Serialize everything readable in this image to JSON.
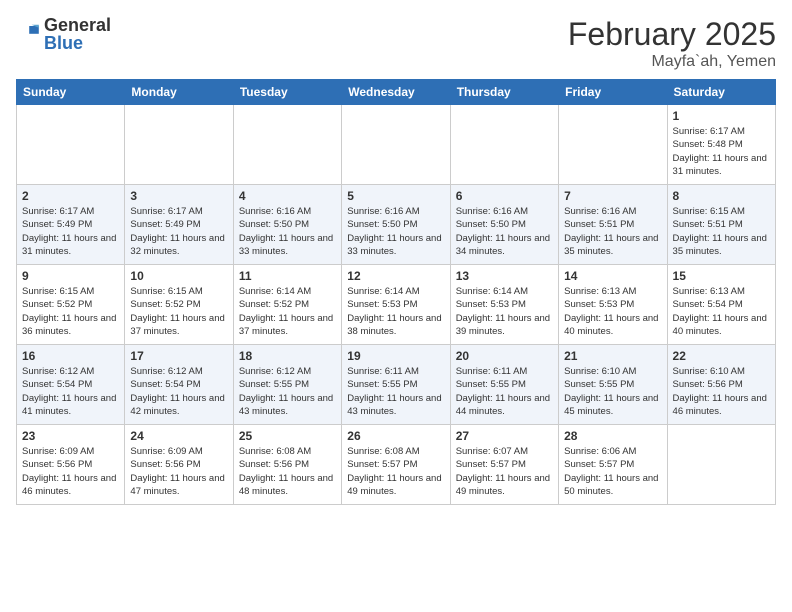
{
  "header": {
    "logo": {
      "general": "General",
      "blue": "Blue"
    },
    "month": "February 2025",
    "location": "Mayfa`ah, Yemen"
  },
  "weekdays": [
    "Sunday",
    "Monday",
    "Tuesday",
    "Wednesday",
    "Thursday",
    "Friday",
    "Saturday"
  ],
  "weeks": [
    [
      {
        "day": "",
        "info": ""
      },
      {
        "day": "",
        "info": ""
      },
      {
        "day": "",
        "info": ""
      },
      {
        "day": "",
        "info": ""
      },
      {
        "day": "",
        "info": ""
      },
      {
        "day": "",
        "info": ""
      },
      {
        "day": "1",
        "info": "Sunrise: 6:17 AM\nSunset: 5:48 PM\nDaylight: 11 hours and 31 minutes."
      }
    ],
    [
      {
        "day": "2",
        "info": "Sunrise: 6:17 AM\nSunset: 5:49 PM\nDaylight: 11 hours and 31 minutes."
      },
      {
        "day": "3",
        "info": "Sunrise: 6:17 AM\nSunset: 5:49 PM\nDaylight: 11 hours and 32 minutes."
      },
      {
        "day": "4",
        "info": "Sunrise: 6:16 AM\nSunset: 5:50 PM\nDaylight: 11 hours and 33 minutes."
      },
      {
        "day": "5",
        "info": "Sunrise: 6:16 AM\nSunset: 5:50 PM\nDaylight: 11 hours and 33 minutes."
      },
      {
        "day": "6",
        "info": "Sunrise: 6:16 AM\nSunset: 5:50 PM\nDaylight: 11 hours and 34 minutes."
      },
      {
        "day": "7",
        "info": "Sunrise: 6:16 AM\nSunset: 5:51 PM\nDaylight: 11 hours and 35 minutes."
      },
      {
        "day": "8",
        "info": "Sunrise: 6:15 AM\nSunset: 5:51 PM\nDaylight: 11 hours and 35 minutes."
      }
    ],
    [
      {
        "day": "9",
        "info": "Sunrise: 6:15 AM\nSunset: 5:52 PM\nDaylight: 11 hours and 36 minutes."
      },
      {
        "day": "10",
        "info": "Sunrise: 6:15 AM\nSunset: 5:52 PM\nDaylight: 11 hours and 37 minutes."
      },
      {
        "day": "11",
        "info": "Sunrise: 6:14 AM\nSunset: 5:52 PM\nDaylight: 11 hours and 37 minutes."
      },
      {
        "day": "12",
        "info": "Sunrise: 6:14 AM\nSunset: 5:53 PM\nDaylight: 11 hours and 38 minutes."
      },
      {
        "day": "13",
        "info": "Sunrise: 6:14 AM\nSunset: 5:53 PM\nDaylight: 11 hours and 39 minutes."
      },
      {
        "day": "14",
        "info": "Sunrise: 6:13 AM\nSunset: 5:53 PM\nDaylight: 11 hours and 40 minutes."
      },
      {
        "day": "15",
        "info": "Sunrise: 6:13 AM\nSunset: 5:54 PM\nDaylight: 11 hours and 40 minutes."
      }
    ],
    [
      {
        "day": "16",
        "info": "Sunrise: 6:12 AM\nSunset: 5:54 PM\nDaylight: 11 hours and 41 minutes."
      },
      {
        "day": "17",
        "info": "Sunrise: 6:12 AM\nSunset: 5:54 PM\nDaylight: 11 hours and 42 minutes."
      },
      {
        "day": "18",
        "info": "Sunrise: 6:12 AM\nSunset: 5:55 PM\nDaylight: 11 hours and 43 minutes."
      },
      {
        "day": "19",
        "info": "Sunrise: 6:11 AM\nSunset: 5:55 PM\nDaylight: 11 hours and 43 minutes."
      },
      {
        "day": "20",
        "info": "Sunrise: 6:11 AM\nSunset: 5:55 PM\nDaylight: 11 hours and 44 minutes."
      },
      {
        "day": "21",
        "info": "Sunrise: 6:10 AM\nSunset: 5:55 PM\nDaylight: 11 hours and 45 minutes."
      },
      {
        "day": "22",
        "info": "Sunrise: 6:10 AM\nSunset: 5:56 PM\nDaylight: 11 hours and 46 minutes."
      }
    ],
    [
      {
        "day": "23",
        "info": "Sunrise: 6:09 AM\nSunset: 5:56 PM\nDaylight: 11 hours and 46 minutes."
      },
      {
        "day": "24",
        "info": "Sunrise: 6:09 AM\nSunset: 5:56 PM\nDaylight: 11 hours and 47 minutes."
      },
      {
        "day": "25",
        "info": "Sunrise: 6:08 AM\nSunset: 5:56 PM\nDaylight: 11 hours and 48 minutes."
      },
      {
        "day": "26",
        "info": "Sunrise: 6:08 AM\nSunset: 5:57 PM\nDaylight: 11 hours and 49 minutes."
      },
      {
        "day": "27",
        "info": "Sunrise: 6:07 AM\nSunset: 5:57 PM\nDaylight: 11 hours and 49 minutes."
      },
      {
        "day": "28",
        "info": "Sunrise: 6:06 AM\nSunset: 5:57 PM\nDaylight: 11 hours and 50 minutes."
      },
      {
        "day": "",
        "info": ""
      }
    ]
  ]
}
